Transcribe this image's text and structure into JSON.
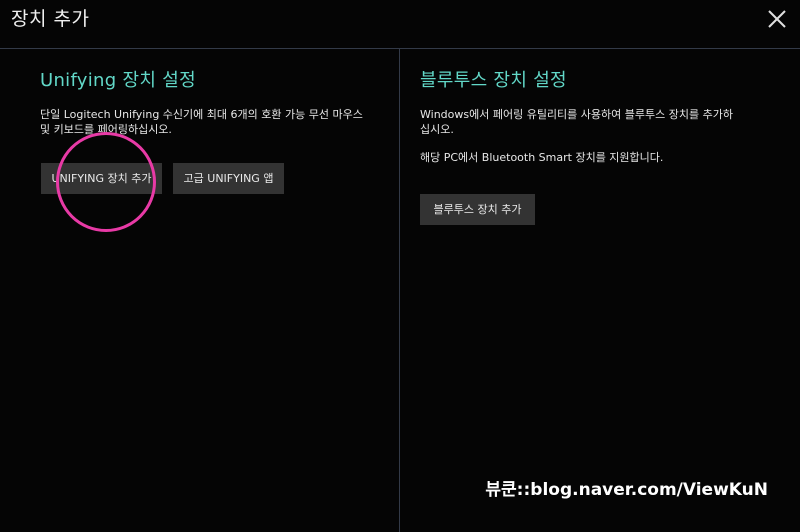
{
  "window": {
    "title": "장치 추가",
    "close_icon": "close-icon"
  },
  "left_panel": {
    "heading": "Unifying 장치 설정",
    "description": "단일 Logitech Unifying 수신기에 최대 6개의 호환 가능 무선 마우스\n및 키보드를 페어링하십시오.",
    "buttons": [
      {
        "label": "UNIFYING 장치 추가"
      },
      {
        "label": "고급 UNIFYING 앱"
      }
    ]
  },
  "right_panel": {
    "heading": "블루투스 장치 설정",
    "description": "Windows에서 페어링 유틸리티를 사용하여 블루투스 장치를 추가하\n십시오.",
    "note": "해당 PC에서 Bluetooth Smart 장치를 지원합니다.",
    "buttons": [
      {
        "label": "블루투스 장치 추가"
      }
    ]
  },
  "watermark": "뷰쿤::blog.naver.com/ViewKuN",
  "colors": {
    "accent": "#62d8c8",
    "highlight_circle": "#e83aa6",
    "button_bg": "#333333",
    "background": "#050505"
  }
}
